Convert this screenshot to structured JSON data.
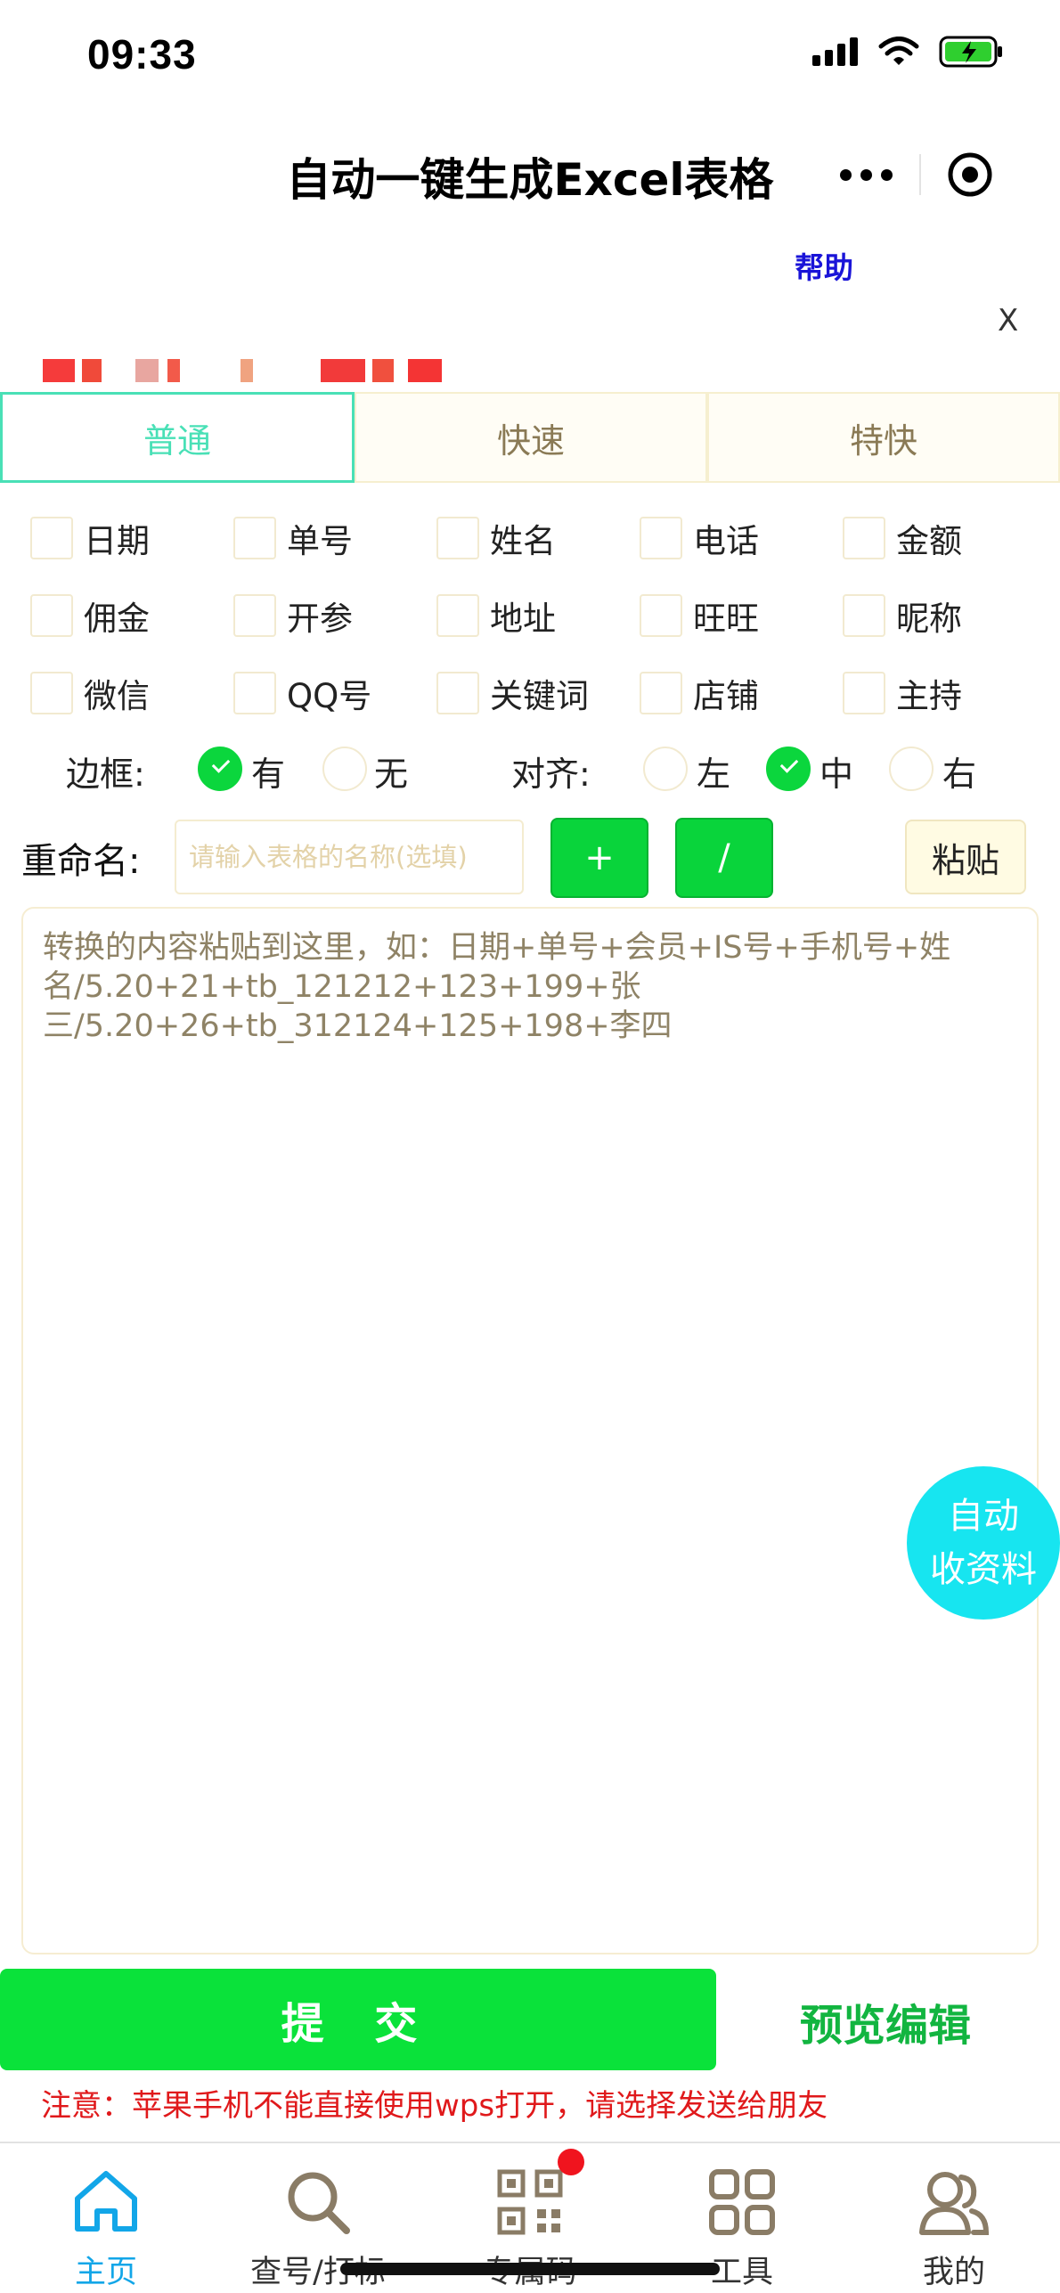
{
  "status_bar": {
    "time": "09:33"
  },
  "nav": {
    "title": "自动一键生成Excel表格"
  },
  "help": "帮助",
  "close": "X",
  "tabs": [
    {
      "label": "普通",
      "active": true
    },
    {
      "label": "快速",
      "active": false
    },
    {
      "label": "特快",
      "active": false
    }
  ],
  "fields": [
    [
      "日期",
      "单号",
      "姓名",
      "电话",
      "金额"
    ],
    [
      "佣金",
      "开参",
      "地址",
      "旺旺",
      "昵称"
    ],
    [
      "微信",
      "QQ号",
      "关键词",
      "店铺",
      "主持"
    ]
  ],
  "options": {
    "border_label": "边框:",
    "border_yes": "有",
    "border_no": "无",
    "align_label": "对齐:",
    "align_left": "左",
    "align_center": "中",
    "align_right": "右"
  },
  "rename": {
    "label": "重命名:",
    "placeholder": "请输入表格的名称(选填)",
    "plus": "+",
    "slash": "/",
    "paste": "粘贴"
  },
  "content": {
    "placeholder": "转换的内容粘贴到这里，如：日期+单号+会员+IS号+手机号+姓名/5.20+21+tb_121212+123+199+张三/5.20+26+tb_312124+125+198+李四"
  },
  "fab": {
    "line1": "自动",
    "line2": "收资料"
  },
  "submit": "提 交",
  "preview": "预览编辑",
  "notice": "注意：苹果手机不能直接使用wps打开，请选择发送给朋友",
  "tabbar": [
    {
      "label": "主页",
      "icon": "home-icon",
      "active": true
    },
    {
      "label": "查号/打标",
      "icon": "search-icon",
      "active": false
    },
    {
      "label": "专属码",
      "icon": "qrcode-icon",
      "active": false
    },
    {
      "label": "工具",
      "icon": "grid-icon",
      "active": false
    },
    {
      "label": "我的",
      "icon": "users-icon",
      "active": false
    }
  ],
  "colors": {
    "accent": "#0ae23a",
    "tab_active": "#49e0b6",
    "notice": "#e0191b",
    "help": "#1a14d8",
    "fab": "#17e5f0",
    "tabbar_active": "#12a6e8"
  }
}
